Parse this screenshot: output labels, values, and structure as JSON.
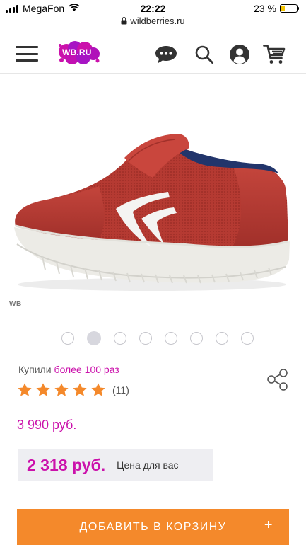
{
  "status_bar": {
    "carrier": "MegaFon",
    "time": "22:22",
    "battery": "23 %",
    "battery_level": 0.23,
    "url": "wildberries.ru"
  },
  "header": {
    "logo_text": "WB.RU",
    "icons": [
      "menu-icon",
      "chat-icon",
      "search-icon",
      "account-icon",
      "cart-icon"
    ]
  },
  "product": {
    "brand_mark": "WB",
    "image_count": 8,
    "active_image_index": 1
  },
  "info": {
    "bought_label": "Купили",
    "bought_value": "более 100 раз",
    "rating": 5,
    "reviews": "(11)",
    "old_price": "3 990 руб.",
    "price": "2 318 руб.",
    "price_note": "Цена для вас"
  },
  "actions": {
    "add_to_cart_label": "ДОБАВИТЬ В КОРЗИНУ",
    "add_to_cart_plus": "+"
  },
  "colors": {
    "accent": "#cb11ab",
    "button": "#f4892b",
    "star": "#f4892b",
    "price_box": "#eeeef2"
  }
}
